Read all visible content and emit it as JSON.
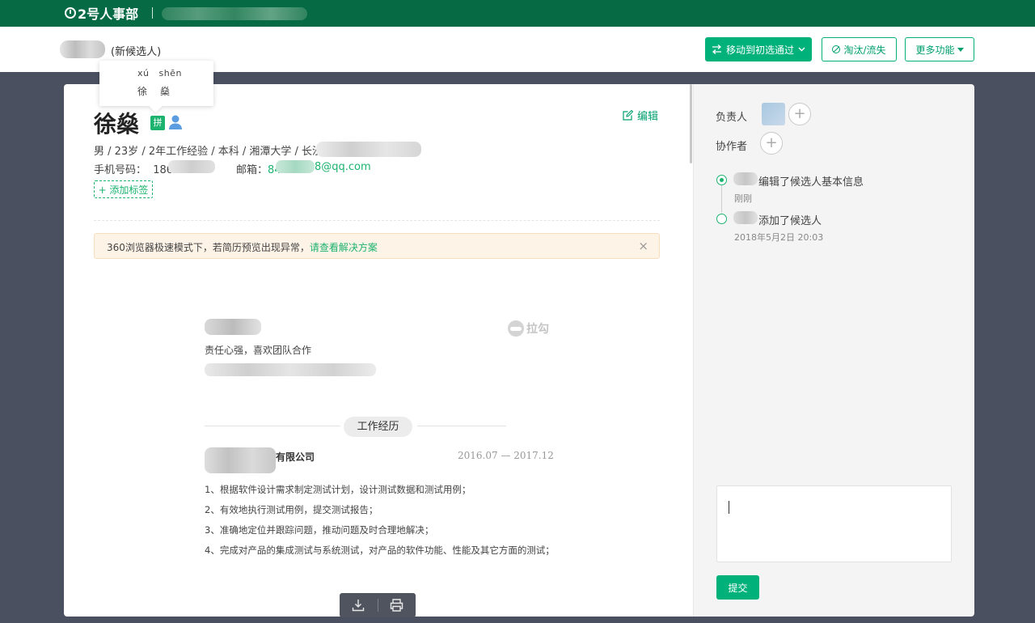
{
  "topbar": {
    "logo_text": "2号人事部"
  },
  "header": {
    "new_candidate": "(新候选人)",
    "move_button": "移动到初选通过",
    "eliminate_button": "淘汰/流失",
    "more_button": "更多功能"
  },
  "pinyin_tooltip": {
    "pinyin": "xú   shēn",
    "hanzi": "徐燊"
  },
  "candidate": {
    "name": "徐燊",
    "pinyin_badge": "拼",
    "edit_label": "编辑",
    "meta": "男 / 23岁 / 2年工作经验 / 本科 / 湘潭大学 / 长沙",
    "phone_label": "手机号码：  186",
    "email_label": "邮箱：",
    "email_prefix": "84",
    "email_tail": "8@qq.com",
    "add_tag": "+ 添加标签"
  },
  "notice": {
    "text": "360浏览器极速模式下，若简历预览出现异常，",
    "link": "请查看解决方案",
    "close": "×"
  },
  "resume": {
    "motto": "责任心强，喜欢团队合作",
    "watermark": "拉勾",
    "section_title": "工作经历",
    "company_suffix": "有限公司",
    "date_range": "2016.07 — 2017.12",
    "duties": [
      "1、根据软件设计需求制定测试计划，设计测试数据和测试用例；",
      "2、有效地执行测试用例，提交测试报告；",
      "3、准确地定位并跟踪问题，推动问题及时合理地解决；",
      "4、完成对产品的集成测试与系统测试，对产品的软件功能、性能及其它方面的测试；"
    ]
  },
  "side": {
    "owner_label": "负责人",
    "collab_label": "协作者",
    "timeline": [
      {
        "text": "编辑了候选人基本信息",
        "time": "刚刚"
      },
      {
        "text": "添加了候选人",
        "time": "2018年5月2日 20:03"
      }
    ],
    "submit": "提交"
  }
}
